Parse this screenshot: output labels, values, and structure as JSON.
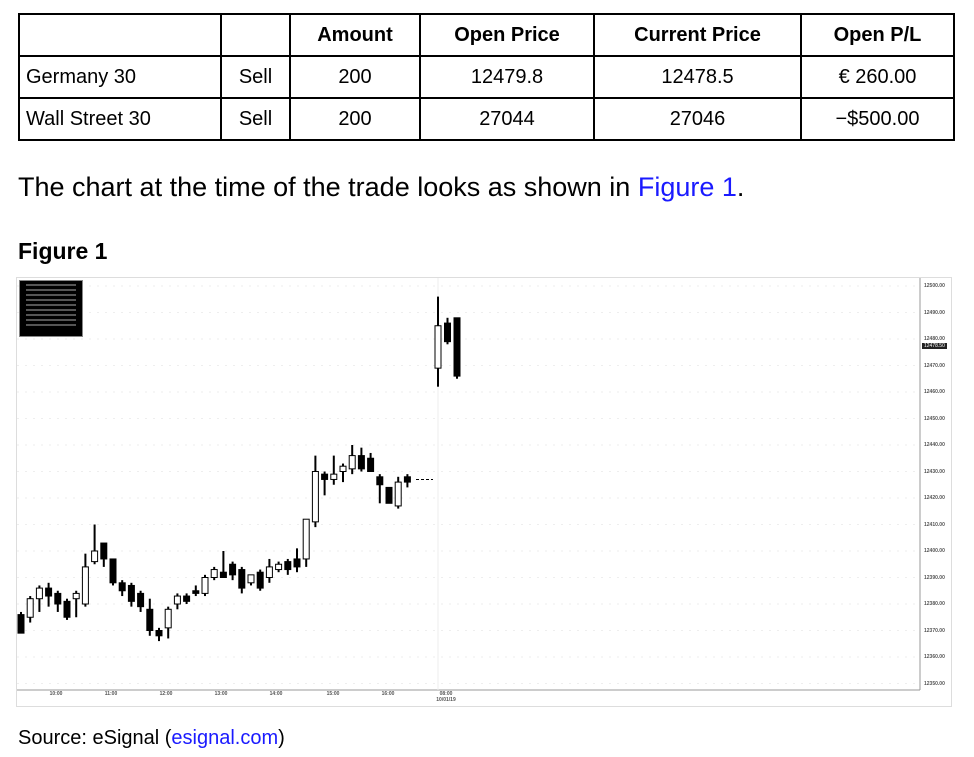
{
  "table": {
    "headers": [
      "",
      "",
      "Amount",
      "Open Price",
      "Current Price",
      "Open P/L"
    ],
    "rows": [
      {
        "market": "Germany 30",
        "direction": "Sell",
        "amount": "200",
        "open_price": "12479.8",
        "current_price": "12478.5",
        "open_pl": "€ 260.00"
      },
      {
        "market": "Wall Street 30",
        "direction": "Sell",
        "amount": "200",
        "open_price": "27044",
        "current_price": "27046",
        "open_pl": "−$500.00"
      }
    ]
  },
  "intro": {
    "text": "The chart at the time of the trade looks as shown in ",
    "link": "Figure 1",
    "end": "."
  },
  "figure_title": "Figure 1",
  "chart_data": {
    "type": "candlestick",
    "ylim": [
      12345,
      12502
    ],
    "y_ticks": [
      "12500.00",
      "12490.00",
      "12480.00",
      "12470.00",
      "12460.00",
      "12450.00",
      "12440.00",
      "12430.00",
      "12420.00",
      "12410.00",
      "12400.00",
      "12390.00",
      "12380.00",
      "12370.00",
      "12360.00",
      "12350.00"
    ],
    "x_ticks": [
      "10:00",
      "11:00",
      "12:00",
      "13:00",
      "14:00",
      "15:00",
      "16:00",
      "08:00"
    ],
    "x_date_label": "10/01/19",
    "current_price_label": "12478.50",
    "grid": true,
    "colors": {
      "up": "#ffffff",
      "down": "#000000",
      "outline": "#000000"
    },
    "candles": [
      {
        "d": 0,
        "o": 12376,
        "h": 12377,
        "l": 12369,
        "c": 12369
      },
      {
        "d": 0,
        "o": 12375,
        "h": 12383,
        "l": 12373,
        "c": 12382
      },
      {
        "d": 0,
        "o": 12382,
        "h": 12387,
        "l": 12377,
        "c": 12386
      },
      {
        "d": 0,
        "o": 12386,
        "h": 12388,
        "l": 12379,
        "c": 12383
      },
      {
        "d": 0,
        "o": 12384,
        "h": 12385,
        "l": 12377,
        "c": 12380
      },
      {
        "d": 0,
        "o": 12381,
        "h": 12382,
        "l": 12374,
        "c": 12375
      },
      {
        "d": 0,
        "o": 12382,
        "h": 12385,
        "l": 12375,
        "c": 12384
      },
      {
        "d": 0,
        "o": 12380,
        "h": 12399,
        "l": 12379,
        "c": 12394
      },
      {
        "d": 0,
        "o": 12396,
        "h": 12410,
        "l": 12395,
        "c": 12400
      },
      {
        "d": 0,
        "o": 12403,
        "h": 12403,
        "l": 12394,
        "c": 12397
      },
      {
        "d": 0,
        "o": 12397,
        "h": 12397,
        "l": 12387,
        "c": 12388
      },
      {
        "d": 0,
        "o": 12388,
        "h": 12389,
        "l": 12383,
        "c": 12385
      },
      {
        "d": 0,
        "o": 12387,
        "h": 12388,
        "l": 12379,
        "c": 12381
      },
      {
        "d": 0,
        "o": 12384,
        "h": 12385,
        "l": 12377,
        "c": 12379
      },
      {
        "d": 0,
        "o": 12378,
        "h": 12382,
        "l": 12368,
        "c": 12370
      },
      {
        "d": 0,
        "o": 12370,
        "h": 12371,
        "l": 12366,
        "c": 12368
      },
      {
        "d": 0,
        "o": 12371,
        "h": 12379,
        "l": 12367,
        "c": 12378
      },
      {
        "d": 0,
        "o": 12380,
        "h": 12384,
        "l": 12378,
        "c": 12383
      },
      {
        "d": 0,
        "o": 12383,
        "h": 12384,
        "l": 12380,
        "c": 12381
      },
      {
        "d": 0,
        "o": 12385,
        "h": 12387,
        "l": 12383,
        "c": 12384
      },
      {
        "d": 0,
        "o": 12384,
        "h": 12391,
        "l": 12383,
        "c": 12390
      },
      {
        "d": 0,
        "o": 12390,
        "h": 12394,
        "l": 12389,
        "c": 12393
      },
      {
        "d": 0,
        "o": 12392,
        "h": 12400,
        "l": 12390,
        "c": 12390
      },
      {
        "d": 0,
        "o": 12395,
        "h": 12396,
        "l": 12389,
        "c": 12391
      },
      {
        "d": 0,
        "o": 12393,
        "h": 12394,
        "l": 12384,
        "c": 12386
      },
      {
        "d": 0,
        "o": 12388,
        "h": 12391,
        "l": 12387,
        "c": 12391
      },
      {
        "d": 0,
        "o": 12392,
        "h": 12393,
        "l": 12385,
        "c": 12386
      },
      {
        "d": 0,
        "o": 12390,
        "h": 12397,
        "l": 12388,
        "c": 12394
      },
      {
        "d": 0,
        "o": 12393,
        "h": 12396,
        "l": 12392,
        "c": 12395
      },
      {
        "d": 0,
        "o": 12396,
        "h": 12397,
        "l": 12391,
        "c": 12393
      },
      {
        "d": 0,
        "o": 12397,
        "h": 12401,
        "l": 12392,
        "c": 12394
      },
      {
        "d": 0,
        "o": 12397,
        "h": 12412,
        "l": 12394,
        "c": 12412
      },
      {
        "d": 0,
        "o": 12411,
        "h": 12436,
        "l": 12409,
        "c": 12430
      },
      {
        "d": 0,
        "o": 12429,
        "h": 12430,
        "l": 12421,
        "c": 12427
      },
      {
        "d": 0,
        "o": 12427,
        "h": 12436,
        "l": 12425,
        "c": 12429
      },
      {
        "d": 0,
        "o": 12430,
        "h": 12433,
        "l": 12426,
        "c": 12432
      },
      {
        "d": 0,
        "o": 12431,
        "h": 12440,
        "l": 12429,
        "c": 12436
      },
      {
        "d": 0,
        "o": 12436,
        "h": 12439,
        "l": 12430,
        "c": 12431
      },
      {
        "d": 0,
        "o": 12435,
        "h": 12437,
        "l": 12430,
        "c": 12430
      },
      {
        "d": 0,
        "o": 12428,
        "h": 12429,
        "l": 12418,
        "c": 12425
      },
      {
        "d": 0,
        "o": 12424,
        "h": 12424,
        "l": 12418,
        "c": 12418
      },
      {
        "d": 0,
        "o": 12417,
        "h": 12428,
        "l": 12416,
        "c": 12426
      },
      {
        "d": 0,
        "o": 12428,
        "h": 12429,
        "l": 12424,
        "c": 12426
      },
      {
        "d": 1,
        "o": 12469,
        "h": 12496,
        "l": 12462,
        "c": 12485
      },
      {
        "d": 1,
        "o": 12486,
        "h": 12488,
        "l": 12478,
        "c": 12479
      },
      {
        "d": 1,
        "o": 12488,
        "h": 12488,
        "l": 12465,
        "c": 12466
      }
    ]
  },
  "source": {
    "text": "Source: eSignal (",
    "link": "esignal.com",
    "end": ")"
  }
}
